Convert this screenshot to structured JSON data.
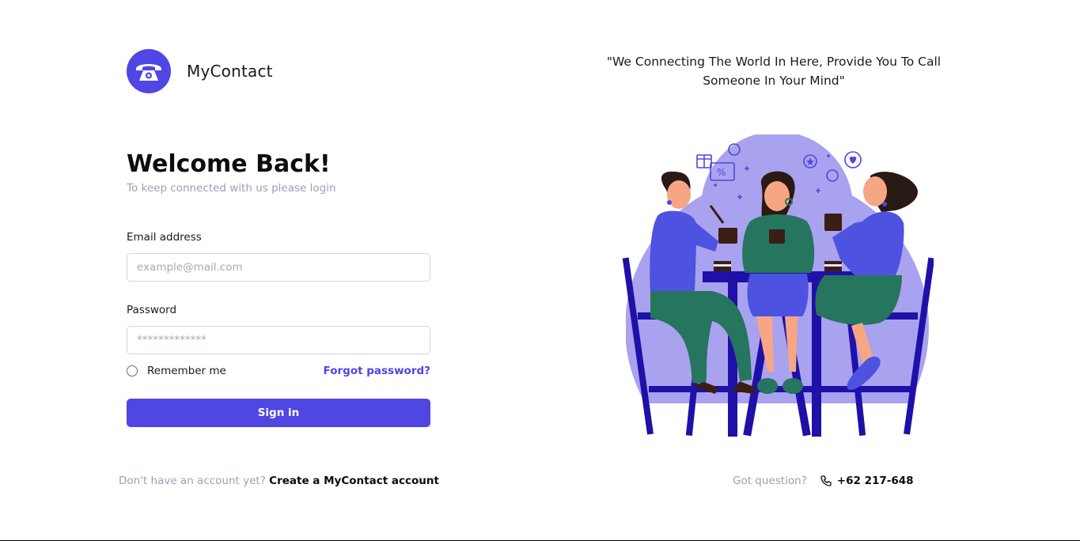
{
  "brand": {
    "name": "MyContact",
    "logo_icon": "telephone-icon",
    "accent": "#5046e4"
  },
  "quote": "\"We Connecting The World In Here, Provide You To Call Someone In Your Mind\"",
  "form": {
    "title": "Welcome Back!",
    "subtitle": "To keep connected with us please login",
    "email": {
      "label": "Email address",
      "placeholder": "example@mail.com",
      "value": ""
    },
    "password": {
      "label": "Password",
      "placeholder": "*************",
      "value": ""
    },
    "remember_label": "Remember me",
    "remember_checked": false,
    "forgot_label": "Forgot password?",
    "signin_label": "Sign in"
  },
  "footer": {
    "signup_prompt": "Don't have an account yet?",
    "signup_link": "Create a MyContact account",
    "question": "Got question?",
    "phone_icon": "phone-icon",
    "phone": "+62 217-648"
  },
  "illustration": {
    "subject": "three-women-at-cafe-table"
  }
}
